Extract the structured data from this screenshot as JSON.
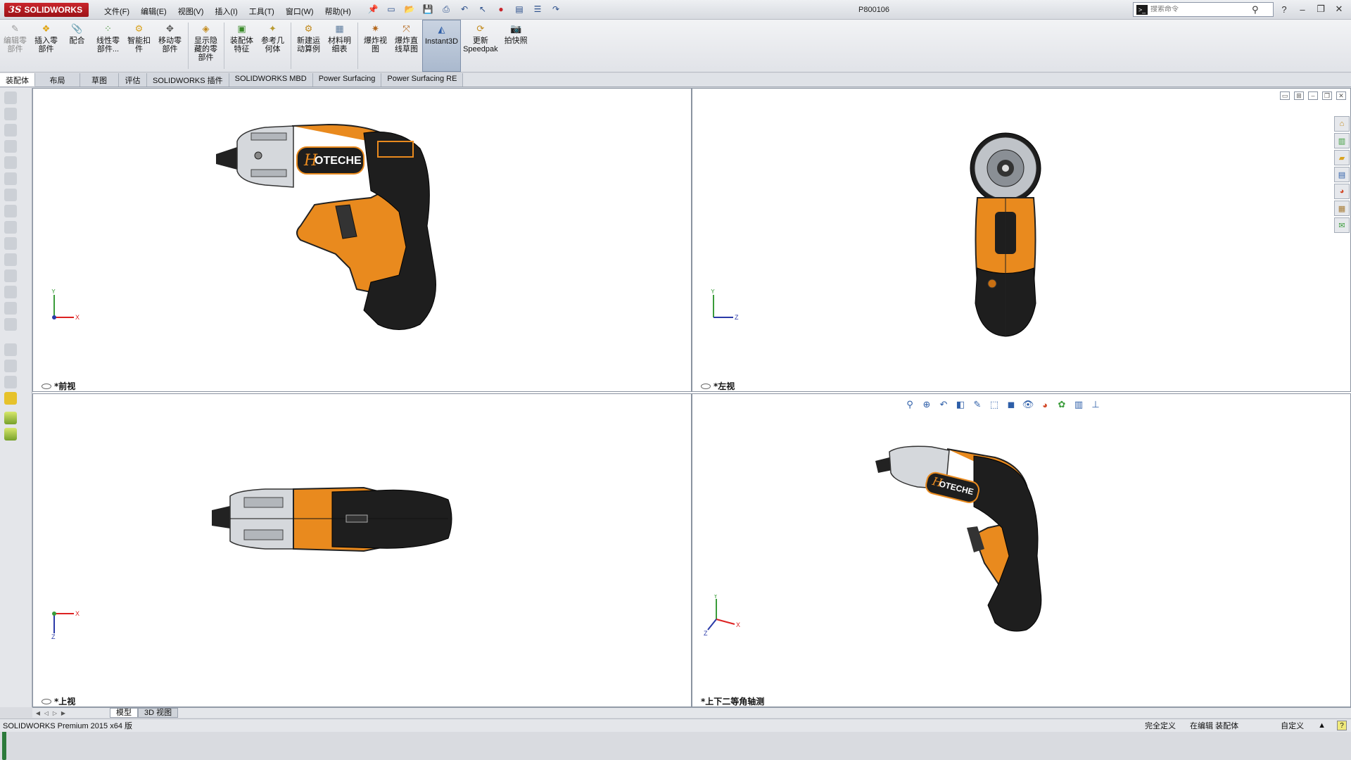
{
  "titlebar": {
    "app_name": "SOLIDWORKS",
    "logo_mark": "3S",
    "menus": [
      "文件(F)",
      "编辑(E)",
      "视图(V)",
      "插入(I)",
      "工具(T)",
      "窗口(W)",
      "帮助(H)"
    ],
    "document_title": "P800106",
    "search_placeholder": "搜索命令"
  },
  "ribbon": {
    "buttons": [
      {
        "label": "编辑零\n部件",
        "disabled": true
      },
      {
        "label": "插入零\n部件"
      },
      {
        "label": "配合"
      },
      {
        "label": "线性零\n部件..."
      },
      {
        "label": "智能扣\n件"
      },
      {
        "label": "移动零\n部件"
      },
      {
        "label": "显示隐\n藏的零\n部件"
      },
      {
        "label": "装配体\n特征"
      },
      {
        "label": "参考几\n何体"
      },
      {
        "label": "新建运\n动算例"
      },
      {
        "label": "材料明\n细表"
      },
      {
        "label": "爆炸视\n图"
      },
      {
        "label": "爆炸直\n线草图"
      },
      {
        "label": "Instant3D",
        "active": true
      },
      {
        "label": "更新\nSpeedpak"
      },
      {
        "label": "拍快照"
      }
    ]
  },
  "tabs": [
    "装配体",
    "布局",
    "草图",
    "评估",
    "SOLIDWORKS 插件",
    "SOLIDWORKS MBD",
    "Power Surfacing",
    "Power Surfacing RE"
  ],
  "viewports": {
    "front": "*前视",
    "left": "*左视",
    "top": "*上视",
    "iso": "*上下二等角轴测"
  },
  "product": {
    "brand": "OTECHE",
    "brand_initial": "H"
  },
  "axes": {
    "x": "X",
    "y": "Y",
    "z": "Z"
  },
  "bottom_tabs": [
    "模型",
    "3D 视图"
  ],
  "status": {
    "left": "SOLIDWORKS Premium 2015 x64 版",
    "definition": "完全定义",
    "mode": "在编辑 装配体",
    "units": "自定义",
    "help": "?"
  },
  "colors": {
    "body_orange": "#e98a1e",
    "grip_black": "#1e1e1e",
    "chrome": "#c9ccd0",
    "accent_red": "#c9252c"
  }
}
